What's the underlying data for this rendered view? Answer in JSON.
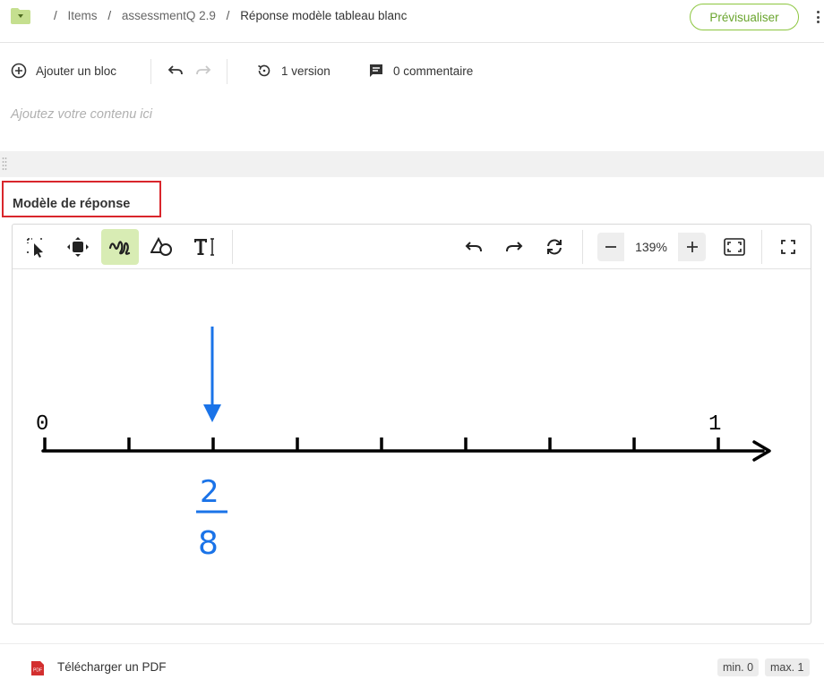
{
  "breadcrumb": {
    "items": [
      "Items",
      "assessmentQ 2.9"
    ],
    "current": "Réponse modèle tableau blanc"
  },
  "header": {
    "preview_label": "Prévisualiser"
  },
  "actions": {
    "add_block_label": "Ajouter un bloc",
    "version_label": "1 version",
    "comment_label": "0 commentaire"
  },
  "content": {
    "placeholder": "Ajoutez votre contenu ici"
  },
  "section": {
    "title": "Modèle de réponse"
  },
  "whiteboard": {
    "zoom_value": "139%",
    "tools": [
      "select-icon",
      "move-icon",
      "freehand-icon",
      "shapes-icon",
      "text-icon"
    ],
    "active_tool": "freehand-icon",
    "drawing": {
      "start_label": "0",
      "end_label": "1",
      "tick_count": 9,
      "marked_tick": 2,
      "fraction_numerator": "2",
      "fraction_denominator": "8",
      "ink_color": "#1a73e8",
      "line_color": "#000000"
    }
  },
  "footer": {
    "pdf_label": "Télécharger un PDF",
    "min_label": "min. 0",
    "max_label": "max. 1"
  },
  "colors": {
    "accent": "#8cc63f",
    "highlight_border": "#d9262c",
    "active_tool_bg": "#d8ecb4"
  }
}
